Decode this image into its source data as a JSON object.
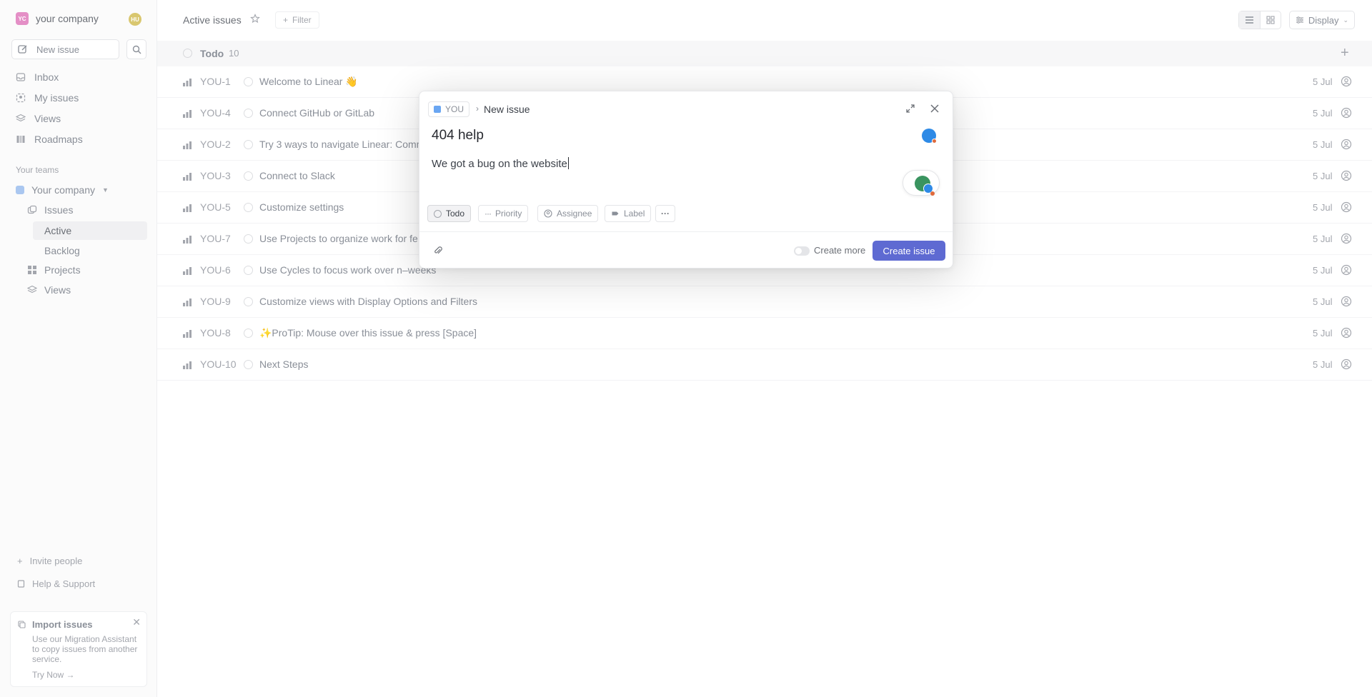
{
  "sidebar": {
    "workspace": {
      "initials": "YC",
      "name": "your company",
      "user_initials": "HU"
    },
    "new_issue_label": "New issue",
    "nav": [
      {
        "label": "Inbox",
        "icon": "inbox-icon"
      },
      {
        "label": "My issues",
        "icon": "my-issues-icon"
      },
      {
        "label": "Views",
        "icon": "views-icon"
      },
      {
        "label": "Roadmaps",
        "icon": "roadmap-icon"
      }
    ],
    "teams_label": "Your teams",
    "team": {
      "name": "Your company",
      "items": {
        "issues": "Issues",
        "active": "Active",
        "backlog": "Backlog",
        "projects": "Projects",
        "views": "Views"
      }
    },
    "invite_label": "Invite people",
    "help_label": "Help & Support",
    "import_card": {
      "title": "Import issues",
      "description": "Use our Migration Assistant to copy issues from another service.",
      "cta": "Try Now →"
    }
  },
  "header": {
    "title": "Active issues",
    "filter_label": "Filter",
    "display_label": "Display"
  },
  "list": {
    "group_label": "Todo",
    "group_count": "10",
    "rows": [
      {
        "id": "YOU-1",
        "title": "Welcome to Linear 👋",
        "date": "5 Jul"
      },
      {
        "id": "YOU-4",
        "title": "Connect GitHub or GitLab",
        "date": "5 Jul"
      },
      {
        "id": "YOU-2",
        "title": "Try 3 ways to navigate Linear: Comm",
        "date": "5 Jul"
      },
      {
        "id": "YOU-3",
        "title": "Connect to Slack",
        "date": "5 Jul"
      },
      {
        "id": "YOU-5",
        "title": "Customize settings",
        "date": "5 Jul"
      },
      {
        "id": "YOU-7",
        "title": "Use Projects to organize work for fe",
        "date": "5 Jul"
      },
      {
        "id": "YOU-6",
        "title": "Use Cycles to focus work over n–weeks",
        "date": "5 Jul"
      },
      {
        "id": "YOU-9",
        "title": "Customize views with Display Options and Filters",
        "date": "5 Jul"
      },
      {
        "id": "YOU-8",
        "title": "✨ProTip: Mouse over this issue & press [Space]",
        "date": "5 Jul"
      },
      {
        "id": "YOU-10",
        "title": "Next Steps",
        "date": "5 Jul"
      }
    ]
  },
  "modal": {
    "team_key": "YOU",
    "breadcrumb_sep": "›",
    "breadcrumb_page": "New issue",
    "title_value": "404 help",
    "description_value": "We got a bug on the website",
    "chips": {
      "status": "Todo",
      "priority": "Priority",
      "assignee": "Assignee",
      "label": "Label"
    },
    "create_more_label": "Create more",
    "create_button_label": "Create issue"
  },
  "colors": {
    "accent": "#5e6ad2",
    "workspace_logo": "#e48fc6",
    "grammarly_blue": "#2e8ae6"
  }
}
